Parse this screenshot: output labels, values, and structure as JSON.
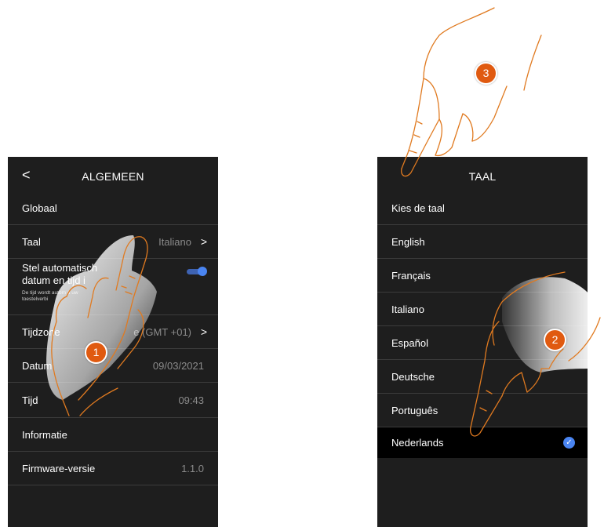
{
  "left": {
    "header_title": "ALGEMEEN",
    "back_glyph": "<",
    "rows": {
      "globaal": "Globaal",
      "taal_label": "Taal",
      "taal_value": "Italiano",
      "auto_label_line1": "Stel automatisch",
      "auto_label_line2": "datum en tijd i",
      "auto_sub_line1": "De tijd wordt autom                a uw",
      "auto_sub_line2": "toestelverbi",
      "auto_toggle_on": true,
      "tijdzone_label": "Tijdzone",
      "tijdzone_value": "e (GMT +01)",
      "datum_label": "Datum",
      "datum_value": "09/03/2021",
      "tijd_label": "Tijd",
      "tijd_value": "09:43",
      "informatie": "Informatie",
      "firmware_label": "Firmware-versie",
      "firmware_value": "1.1.0"
    },
    "chevron": ">"
  },
  "right": {
    "header_title": "TAAL",
    "section_label": "Kies de taal",
    "languages": [
      "English",
      "Français",
      "Italiano",
      "Español",
      "Deutsche",
      "Português",
      "Nederlands"
    ],
    "selected_language": "Nederlands",
    "check_glyph": "✓"
  },
  "badges": [
    "1",
    "2",
    "3"
  ],
  "colors": {
    "screen_bg": "#1e1e1e",
    "accent_blue": "#4a85f2",
    "badge_orange": "#e05a10",
    "hand_outline": "#e07a20"
  },
  "icons": {
    "back": "chevron-left-icon",
    "forward": "chevron-right-icon",
    "toggle": "toggle-on-icon",
    "check": "check-circle-icon"
  }
}
